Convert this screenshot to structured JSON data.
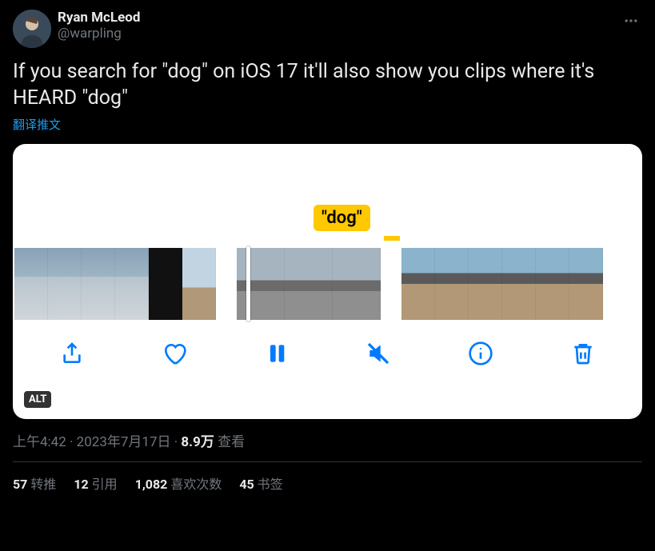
{
  "author": {
    "display_name": "Ryan McLeod",
    "handle": "@warpling"
  },
  "tweet_text": "If you search for \"dog\" on iOS 17 it'll also show you clips where it's HEARD \"dog\"",
  "translate_label": "翻译推文",
  "media": {
    "tooltip": "\"dog\"",
    "alt_badge": "ALT"
  },
  "timestamp": {
    "time": "上午4:42",
    "sep": " · ",
    "date": "2023年7月17日",
    "views_count": "8.9万",
    "views_label": " 查看"
  },
  "stats": {
    "retweets_count": "57",
    "retweets_label": " 转推",
    "quotes_count": "12",
    "quotes_label": " 引用",
    "likes_count": "1,082",
    "likes_label": " 喜欢次数",
    "bookmarks_count": "45",
    "bookmarks_label": " 书签"
  }
}
